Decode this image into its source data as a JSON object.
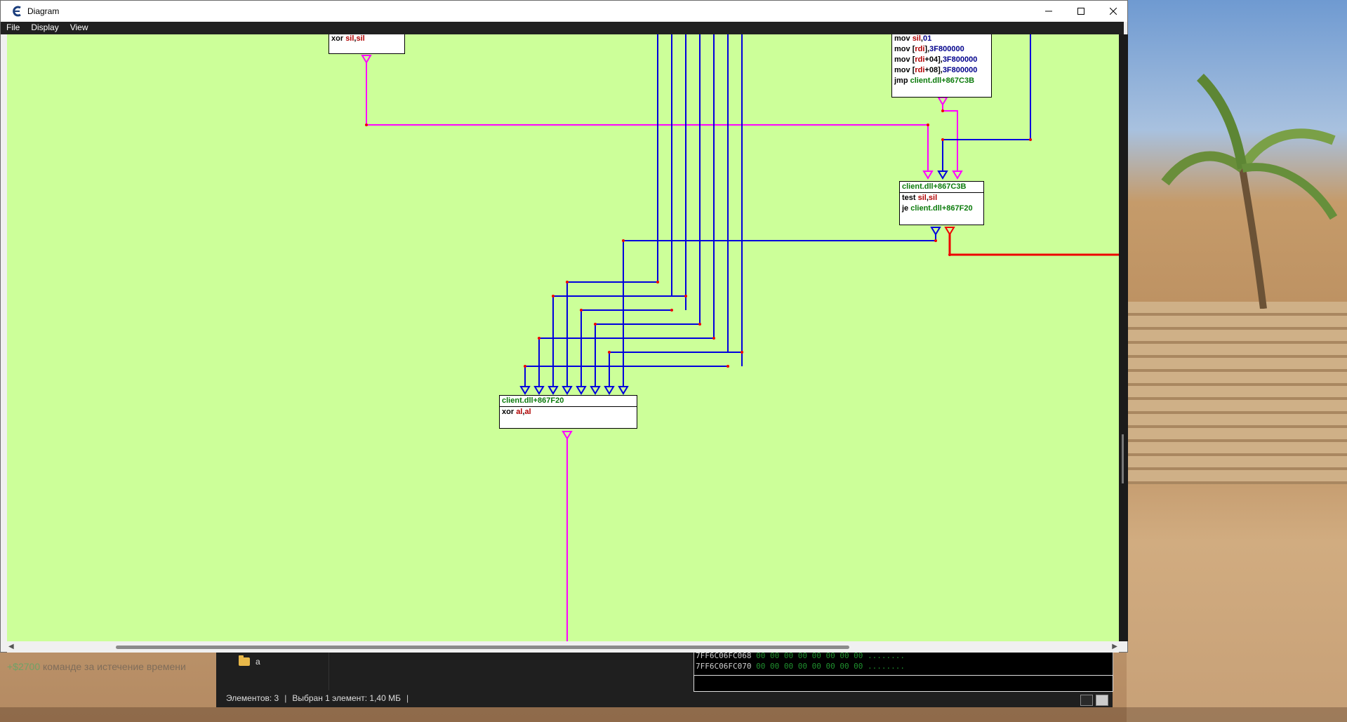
{
  "window": {
    "title": "Diagram",
    "menu": [
      "File",
      "Display",
      "View"
    ]
  },
  "blocks": {
    "top_left": {
      "lines": [
        [
          {
            "t": "xor ",
            "c": "mn"
          },
          {
            "t": "sil",
            "c": "rg"
          },
          {
            "t": ",",
            "c": "mn"
          },
          {
            "t": "sil",
            "c": "rg"
          }
        ]
      ]
    },
    "top_right": {
      "lines": [
        [
          {
            "t": "mov ",
            "c": "mn"
          },
          {
            "t": "sil",
            "c": "rg"
          },
          {
            "t": ",",
            "c": "mn"
          },
          {
            "t": "01",
            "c": "nm"
          }
        ],
        [
          {
            "t": "mov ",
            "c": "mn"
          },
          {
            "t": "[",
            "c": "mn"
          },
          {
            "t": "rdi",
            "c": "rg"
          },
          {
            "t": "],",
            "c": "mn"
          },
          {
            "t": "3F800000",
            "c": "nm"
          }
        ],
        [
          {
            "t": "mov ",
            "c": "mn"
          },
          {
            "t": "[",
            "c": "mn"
          },
          {
            "t": "rdi",
            "c": "rg"
          },
          {
            "t": "+04],",
            "c": "mn"
          },
          {
            "t": "3F800000",
            "c": "nm"
          }
        ],
        [
          {
            "t": "mov ",
            "c": "mn"
          },
          {
            "t": "[",
            "c": "mn"
          },
          {
            "t": "rdi",
            "c": "rg"
          },
          {
            "t": "+08],",
            "c": "mn"
          },
          {
            "t": "3F800000",
            "c": "nm"
          }
        ],
        [
          {
            "t": "jmp ",
            "c": "mn"
          },
          {
            "t": "client.dll+867C3B",
            "c": "lb"
          }
        ]
      ]
    },
    "mid_right": {
      "header": "client.dll+867C3B",
      "lines": [
        [
          {
            "t": "test ",
            "c": "mn"
          },
          {
            "t": "sil",
            "c": "rg"
          },
          {
            "t": ",",
            "c": "mn"
          },
          {
            "t": "sil",
            "c": "rg"
          }
        ],
        [
          {
            "t": "je ",
            "c": "mn"
          },
          {
            "t": "client.dll+867F20",
            "c": "lb"
          }
        ]
      ]
    },
    "center": {
      "header": "client.dll+867F20",
      "lines": [
        [
          {
            "t": "xor ",
            "c": "mn"
          },
          {
            "t": "al",
            "c": "rg"
          },
          {
            "t": ",",
            "c": "mn"
          },
          {
            "t": "al",
            "c": "rg"
          }
        ]
      ]
    }
  },
  "explorer": {
    "folder": "a",
    "hex_rows": [
      {
        "addr": "7FF6C06FC068",
        "bytes": "00 00 00 00 00 00 00 00 ........"
      },
      {
        "addr": "7FF6C06FC070",
        "bytes": "00 00 00 00 00 00 00 00 ........"
      }
    ],
    "status": {
      "count": "Элементов: 3",
      "selected": "Выбран 1 элемент: 1,40 МБ"
    }
  },
  "game": {
    "money": "+$2700",
    "message": " команде за истечение времени"
  },
  "colors": {
    "canvas": "#ccff99",
    "edge_blue": "#0000dd",
    "edge_magenta": "#ff00ff",
    "edge_red": "#ee0000"
  }
}
